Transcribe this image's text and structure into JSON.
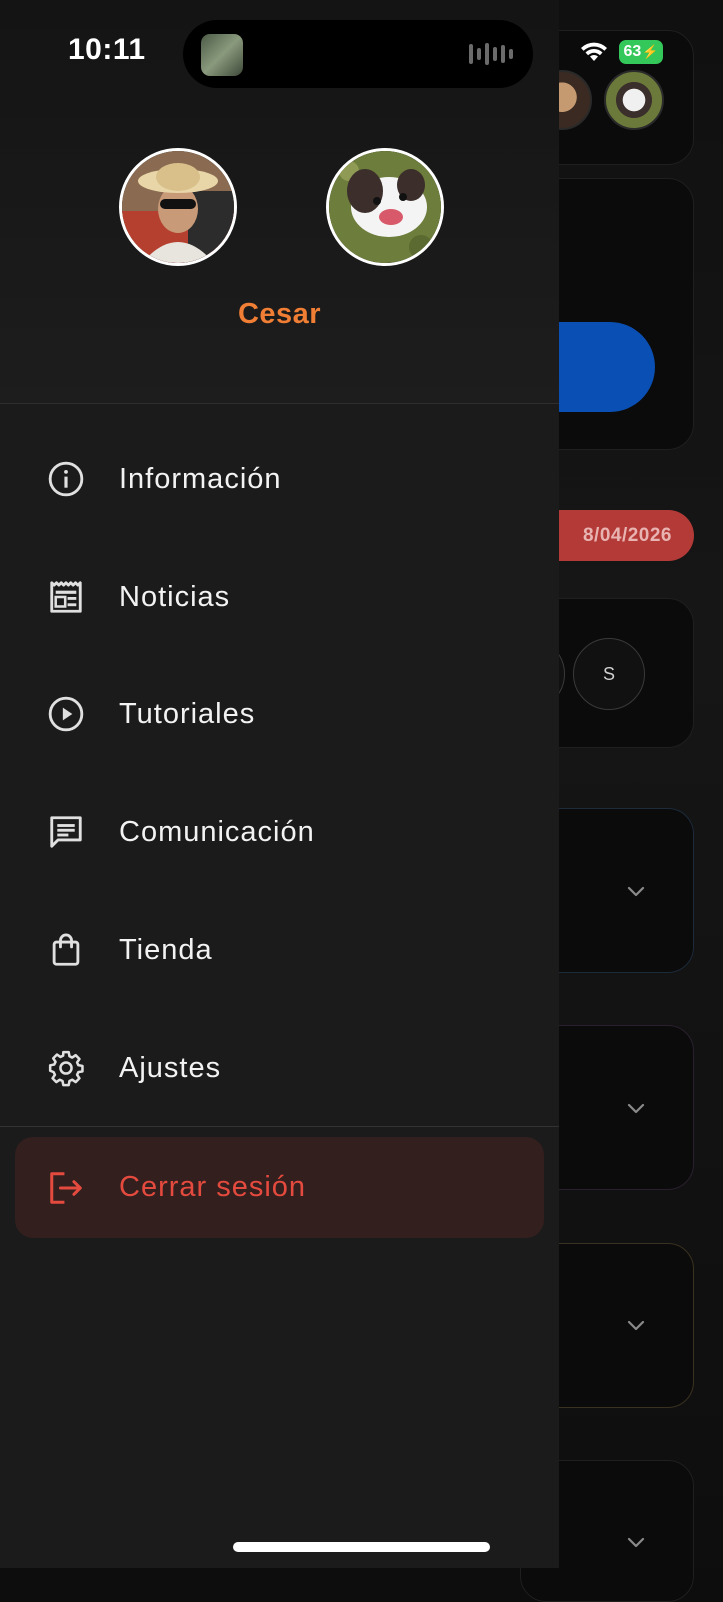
{
  "status_bar": {
    "time": "10:11",
    "battery": "63"
  },
  "drawer": {
    "profile": {
      "name": "Cesar",
      "accent_color": "#f07e34",
      "avatars": [
        {
          "name": "user-avatar"
        },
        {
          "name": "pet-avatar"
        }
      ]
    },
    "menu": [
      {
        "id": "informacion",
        "label": "Información",
        "icon": "info-icon"
      },
      {
        "id": "noticias",
        "label": "Noticias",
        "icon": "newspaper-icon"
      },
      {
        "id": "tutoriales",
        "label": "Tutoriales",
        "icon": "play-circle-icon"
      },
      {
        "id": "comunicacion",
        "label": "Comunicación",
        "icon": "message-icon"
      },
      {
        "id": "tienda",
        "label": "Tienda",
        "icon": "shopping-bag-icon"
      },
      {
        "id": "ajustes",
        "label": "Ajustes",
        "icon": "gear-icon"
      }
    ],
    "logout": {
      "label": "Cerrar sesión",
      "icon": "logout-icon",
      "color": "#e44a3e"
    }
  },
  "background": {
    "date_badge": "8/04/2026",
    "day_circle": "S"
  }
}
